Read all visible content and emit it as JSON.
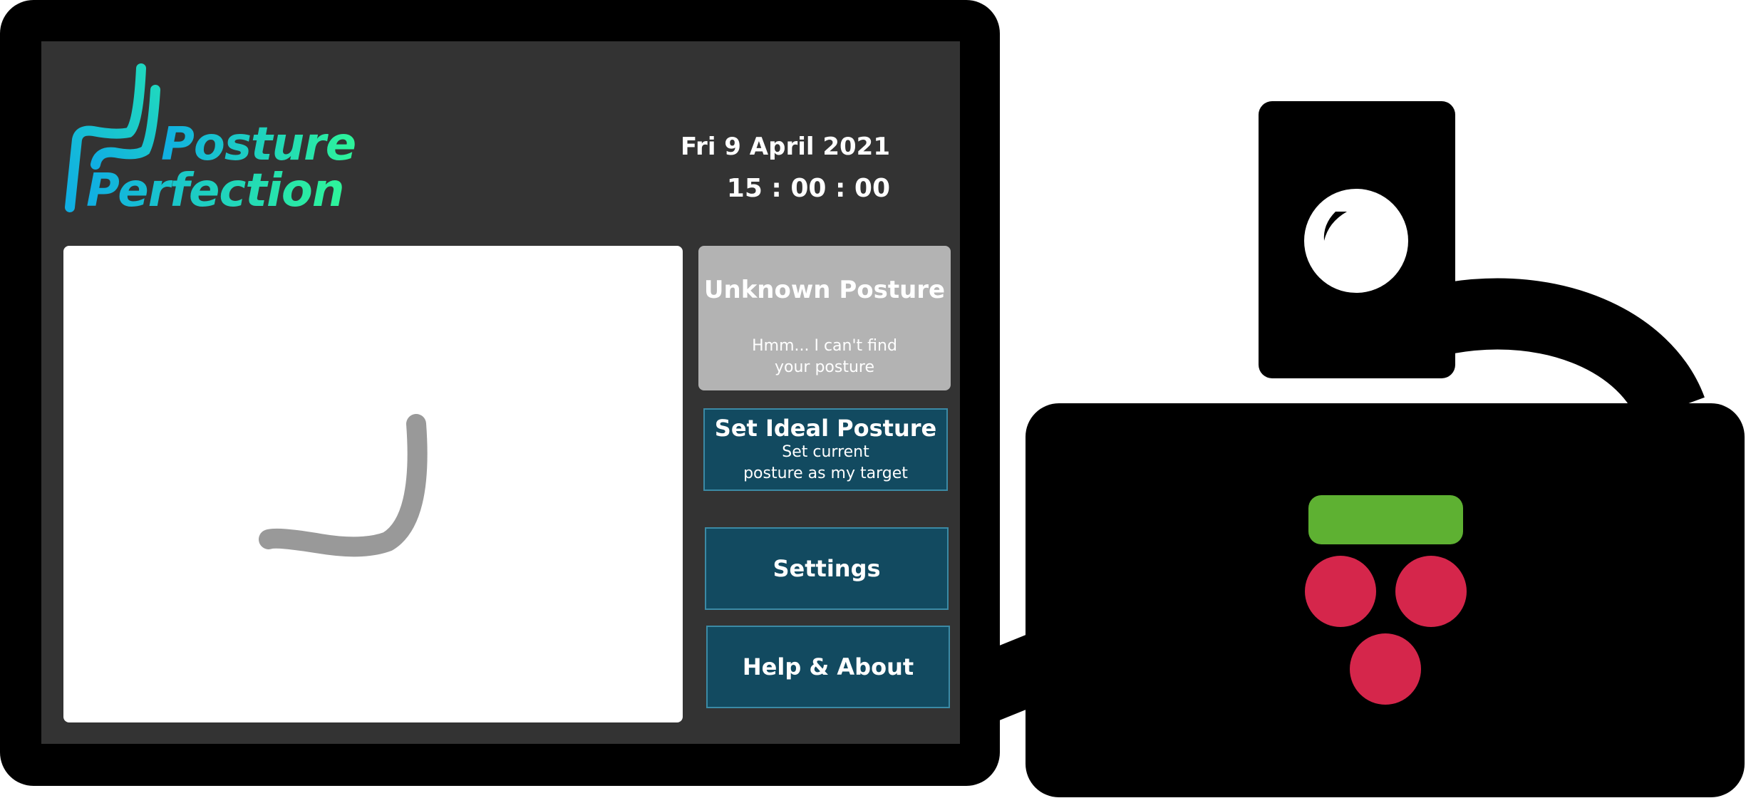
{
  "header": {
    "logo_line1": "Posture",
    "logo_line2": "Perfection",
    "date": "Fri 9 April 2021",
    "time": "15 : 00 : 00"
  },
  "status": {
    "title": "Unknown Posture",
    "message_line1": "Hmm... I can't find",
    "message_line2": "your posture",
    "color": "#b3b3b3"
  },
  "buttons": {
    "ideal": {
      "label": "Set Ideal Posture",
      "sub1": "Set current",
      "sub2": "posture as my target"
    },
    "settings": {
      "label": "Settings"
    },
    "help": {
      "label": "Help & About"
    }
  },
  "colors": {
    "screen": "#333333",
    "button": "#124a60",
    "pi_green": "#5eb132",
    "pi_red": "#d5264b",
    "logo_start": "#10aee3",
    "logo_end": "#2ef59a"
  },
  "icons": {
    "camera": "camera-icon",
    "raspberry_pi": "raspberry-pi-icon"
  }
}
